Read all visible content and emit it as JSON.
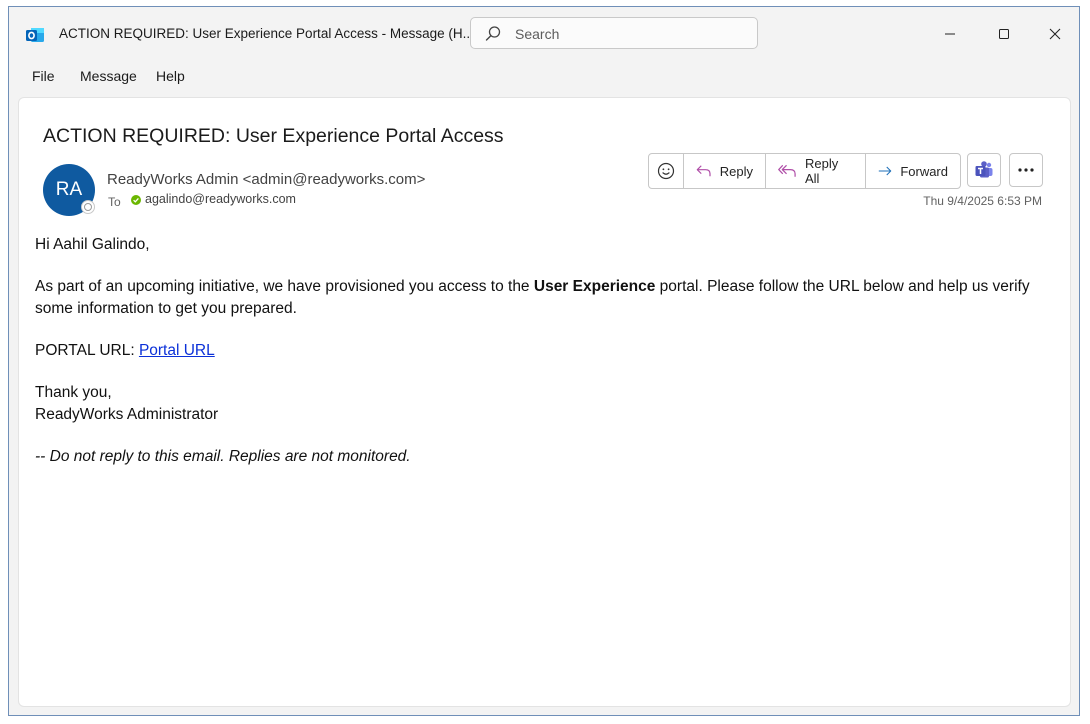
{
  "window": {
    "title": "ACTION REQUIRED: User Experience Portal Access  -  Message (H...",
    "search_placeholder": "Search",
    "controls": [
      "minimize",
      "maximize",
      "close"
    ]
  },
  "menu": {
    "items": [
      "File",
      "Message",
      "Help"
    ]
  },
  "email": {
    "subject": "ACTION REQUIRED: User Experience Portal Access",
    "avatar_initials": "RA",
    "sender": "ReadyWorks Admin <admin@readyworks.com>",
    "to_label": "To",
    "to_address": "agalindo@readyworks.com",
    "date": "Thu 9/4/2025 6:53 PM",
    "actions": {
      "reply": "Reply",
      "reply_all": "Reply All",
      "forward": "Forward"
    },
    "body": {
      "greeting": "Hi Aahil Galindo,",
      "para1_before": "As part of an upcoming initiative, we have provisioned you access to the ",
      "para1_bold": "User Experience",
      "para1_after": " portal. Please follow the URL below and help us verify some information to get you prepared.",
      "portal_label": "PORTAL URL: ",
      "portal_link": "Portal URL",
      "closing": "Thank you,",
      "signature": "ReadyWorks Administrator",
      "footer": "-- Do not reply to this email. Replies are not monitored."
    }
  },
  "colors": {
    "avatar_bg": "#0f5aa0",
    "link": "#0b30d8",
    "presence_green": "#6bb700",
    "reply_icon": "#b04fa8",
    "forward_icon": "#1d6fb8",
    "teams": "#5b5fc7"
  }
}
